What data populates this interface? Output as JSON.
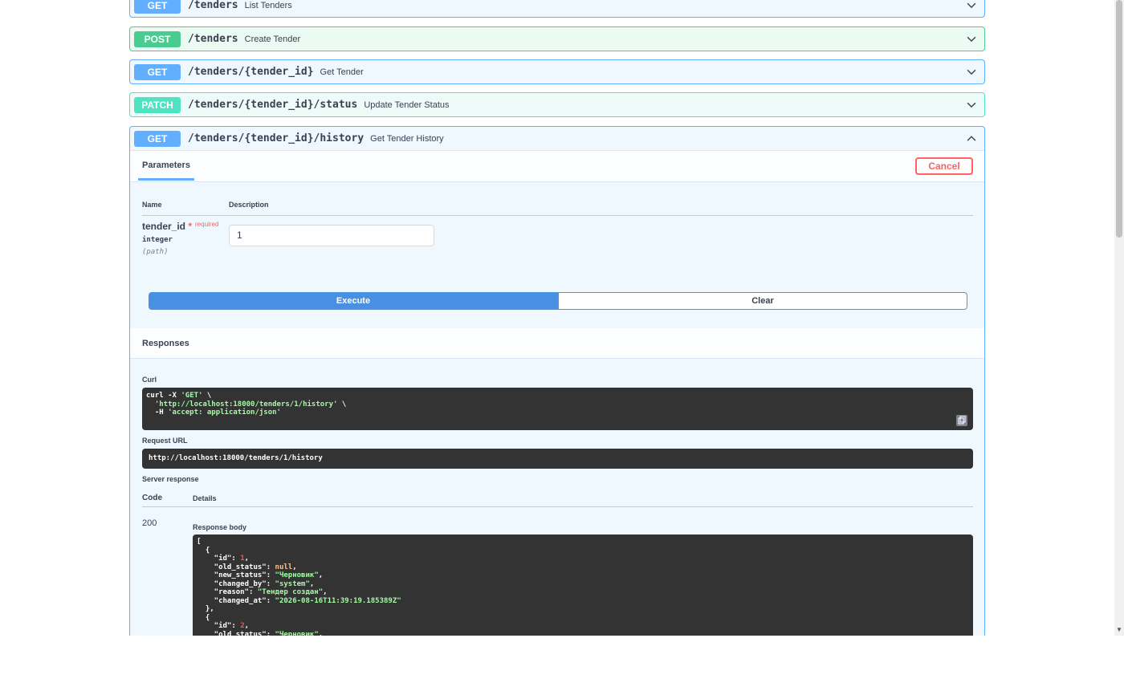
{
  "operations": [
    {
      "method": "GET",
      "path": "/tenders",
      "summary": "List Tenders"
    },
    {
      "method": "POST",
      "path": "/tenders",
      "summary": "Create Tender"
    },
    {
      "method": "GET",
      "path": "/tenders/{tender_id}",
      "summary": "Get Tender"
    },
    {
      "method": "PATCH",
      "path": "/tenders/{tender_id}/status",
      "summary": "Update Tender Status"
    },
    {
      "method": "GET",
      "path": "/tenders/{tender_id}/history",
      "summary": "Get Tender History"
    }
  ],
  "expanded": {
    "tab_label": "Parameters",
    "cancel_label": "Cancel",
    "col_name": "Name",
    "col_description": "Description",
    "param": {
      "name": "tender_id",
      "star": "*",
      "required": "required",
      "type": "integer",
      "in": "(path)",
      "value": "1"
    },
    "execute_label": "Execute",
    "clear_label": "Clear",
    "responses_title": "Responses",
    "curl_label": "Curl",
    "curl_lines": [
      "curl -X ",
      "'GET'",
      " \\",
      "  'http://localhost:18000/tenders/1/history'",
      " \\",
      "  -H ",
      "'accept: application/json'"
    ],
    "request_url_label": "Request URL",
    "request_url": "http://localhost:18000/tenders/1/history",
    "server_response_label": "Server response",
    "code_header": "Code",
    "details_header": "Details",
    "status_code": "200",
    "response_body_label": "Response body",
    "response_body": [
      {
        "id": 1,
        "old_status": null,
        "new_status": "Черновик",
        "changed_by": "system",
        "reason": "Тендер создан",
        "changed_at": "2026-08-16T11:39:19.185389Z"
      },
      {
        "id": 2,
        "old_status": "Черновик"
      }
    ]
  }
}
